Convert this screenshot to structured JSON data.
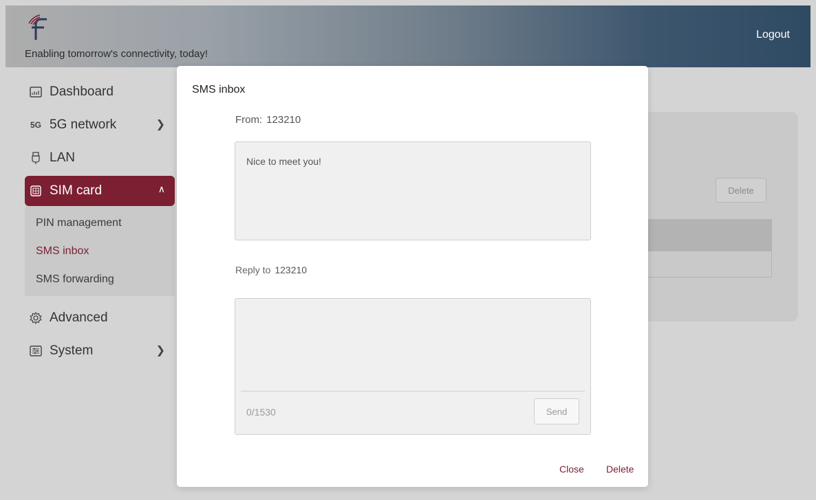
{
  "header": {
    "tagline": "Enabling tomorrow's connectivity, today!",
    "logout_label": "Logout",
    "brand_color": "#7c1f32"
  },
  "sidebar": {
    "items": [
      {
        "label": "Dashboard",
        "icon": "dashboard-icon"
      },
      {
        "label": "5G network",
        "icon": "5g-icon",
        "chevron": "right"
      },
      {
        "label": "LAN",
        "icon": "lan-plug-icon"
      },
      {
        "label": "SIM card",
        "icon": "sim-card-icon",
        "chevron": "up",
        "active": true
      },
      {
        "label": "Advanced",
        "icon": "gear-icon"
      },
      {
        "label": "System",
        "icon": "system-settings-icon",
        "chevron": "right"
      }
    ],
    "sim_subitems": [
      {
        "label": "PIN management"
      },
      {
        "label": "SMS inbox",
        "current": true
      },
      {
        "label": "SMS forwarding"
      }
    ]
  },
  "background": {
    "delete_label": "Delete"
  },
  "modal": {
    "title": "SMS inbox",
    "from_label": "From:",
    "from_number": "123210",
    "message": "Nice to meet you!",
    "reply_label": "Reply to",
    "reply_number": "123210",
    "reply_value": "",
    "counter": "0/1530",
    "send_label": "Send",
    "close_label": "Close",
    "delete_label": "Delete"
  }
}
